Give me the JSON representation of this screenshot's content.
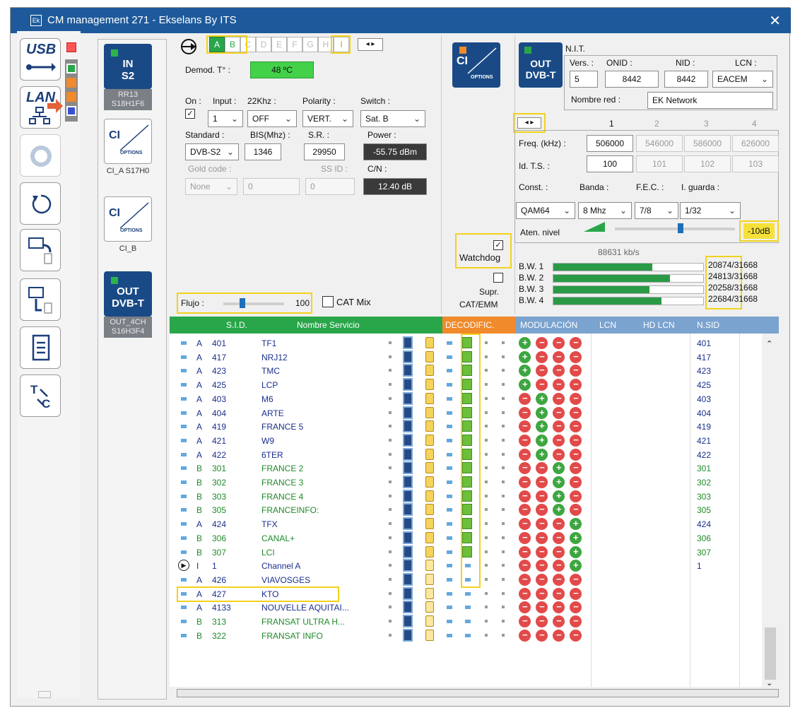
{
  "window": {
    "title": "CM management 271 - Ekselans By ITS",
    "icon": "Ek",
    "close": "✕"
  },
  "left_toolbar": {
    "usb": "USB",
    "lan": "LAN"
  },
  "device_panel": {
    "in_module": {
      "line1": "IN",
      "line2": "S2",
      "caption": "RR13 S18H1F6"
    },
    "ci_a": {
      "label": "CI",
      "sub": "OPTIONS",
      "caption": "CI_A S17H0"
    },
    "ci_b": {
      "label": "CI",
      "sub": "OPTIONS",
      "caption": "CI_B"
    },
    "out_module": {
      "line1": "OUT",
      "line2": "DVB-T",
      "caption": "OUT_4CH S16H3F4"
    }
  },
  "input_panel": {
    "tabs": [
      "A",
      "B",
      "C",
      "D",
      "E",
      "F",
      "G",
      "H",
      "I"
    ],
    "demod_label": "Demod. T° :",
    "demod_value": "48 ºC",
    "on_label": "On :",
    "input_label": "Input :",
    "khz_label": "22Khz :",
    "polarity_label": "Polarity :",
    "switch_label": "Switch :",
    "input_value": "1",
    "khz_value": "OFF",
    "polarity_value": "VERT.",
    "switch_value": "Sat. B",
    "standard_label": "Standard :",
    "bis_label": "BIS(Mhz) :",
    "sr_label": "S.R. :",
    "power_label": "Power :",
    "standard_value": "DVB-S2",
    "bis_value": "1346",
    "sr_value": "29950",
    "power_value": "-55.75 dBm",
    "gold_label": "Gold code :",
    "ssid_label": "SS ID :",
    "cn_label": "C/N :",
    "gold_value": "None",
    "gold_num": "0",
    "ssid_value": "0",
    "cn_value": "12.40 dB",
    "flujo_label": "Flujo :",
    "flujo_value": "100",
    "flujo_level": 0.3,
    "catmix_label": "CAT Mix"
  },
  "ci_panel": {
    "label": "CI",
    "sub": "OPTIONS",
    "watchdog": "Watchdog",
    "supr": "Supr.",
    "catemm": "CAT/EMM"
  },
  "out_panel": {
    "line1": "OUT",
    "line2": "DVB-T",
    "nit": "N.I.T.",
    "vers_label": "Vers. :",
    "onid_label": "ONID :",
    "nid_label": "NID :",
    "lcn_label": "LCN :",
    "vers_value": "5",
    "onid_value": "8442",
    "nid_value": "8442",
    "lcn_value": "EACEM",
    "red_label": "Nombre red :",
    "red_value": "EK Network",
    "channels": [
      "1",
      "2",
      "3",
      "4"
    ],
    "freq_label": "Freq. (kHz) :",
    "freqs": [
      "506000",
      "546000",
      "586000",
      "626000"
    ],
    "ts_label": "Id. T.S. :",
    "ts": [
      "100",
      "101",
      "102",
      "103"
    ],
    "const_label": "Const. :",
    "banda_label": "Banda :",
    "fec_label": "F.E.C. :",
    "guard_label": "I. guarda :",
    "const_value": "QAM64",
    "banda_value": "8 Mhz",
    "fec_value": "7/8",
    "guard_value": "1/32",
    "aten_label": "Aten. nivel",
    "aten_value": "-10dB",
    "aten_level": 0.55,
    "rate": "88631 kb/s",
    "bw": [
      {
        "label": "B.W. 1",
        "value": "20874/31668",
        "fill": 0.66
      },
      {
        "label": "B.W. 2",
        "value": "24813/31668",
        "fill": 0.78
      },
      {
        "label": "B.W. 3",
        "value": "20258/31668",
        "fill": 0.64
      },
      {
        "label": "B.W. 4",
        "value": "22684/31668",
        "fill": 0.72
      }
    ]
  },
  "table": {
    "headers": {
      "sid": "S.I.D.",
      "name": "Nombre Servicio",
      "decod": "DECODIFIC.",
      "mod": "MODULACIÓN",
      "lcn": "LCN",
      "hdlcn": "HD LCN",
      "nsid": "N.SID"
    },
    "rows": [
      {
        "tab": "A",
        "sid": "401",
        "name": "TF1",
        "mod": [
          1,
          0,
          0,
          0
        ],
        "nsid": "401",
        "green": false,
        "dec": true
      },
      {
        "tab": "A",
        "sid": "417",
        "name": "NRJ12",
        "mod": [
          1,
          0,
          0,
          0
        ],
        "nsid": "417",
        "green": false,
        "dec": true
      },
      {
        "tab": "A",
        "sid": "423",
        "name": "TMC",
        "mod": [
          1,
          0,
          0,
          0
        ],
        "nsid": "423",
        "green": false,
        "dec": true
      },
      {
        "tab": "A",
        "sid": "425",
        "name": "LCP",
        "mod": [
          1,
          0,
          0,
          0
        ],
        "nsid": "425",
        "green": false,
        "dec": true
      },
      {
        "tab": "A",
        "sid": "403",
        "name": "M6",
        "mod": [
          0,
          1,
          0,
          0
        ],
        "nsid": "403",
        "green": false,
        "dec": true
      },
      {
        "tab": "A",
        "sid": "404",
        "name": "ARTE",
        "mod": [
          0,
          1,
          0,
          0
        ],
        "nsid": "404",
        "green": false,
        "dec": true
      },
      {
        "tab": "A",
        "sid": "419",
        "name": "FRANCE 5",
        "mod": [
          0,
          1,
          0,
          0
        ],
        "nsid": "419",
        "green": false,
        "dec": true
      },
      {
        "tab": "A",
        "sid": "421",
        "name": "W9",
        "mod": [
          0,
          1,
          0,
          0
        ],
        "nsid": "421",
        "green": false,
        "dec": true
      },
      {
        "tab": "A",
        "sid": "422",
        "name": "6TER",
        "mod": [
          0,
          1,
          0,
          0
        ],
        "nsid": "422",
        "green": false,
        "dec": true
      },
      {
        "tab": "B",
        "sid": "301",
        "name": "FRANCE 2",
        "mod": [
          0,
          0,
          1,
          0
        ],
        "nsid": "301",
        "green": true,
        "dec": true
      },
      {
        "tab": "B",
        "sid": "302",
        "name": "FRANCE 3",
        "mod": [
          0,
          0,
          1,
          0
        ],
        "nsid": "302",
        "green": true,
        "dec": true
      },
      {
        "tab": "B",
        "sid": "303",
        "name": "FRANCE 4",
        "mod": [
          0,
          0,
          1,
          0
        ],
        "nsid": "303",
        "green": true,
        "dec": true
      },
      {
        "tab": "B",
        "sid": "305",
        "name": "FRANCEINFO:",
        "mod": [
          0,
          0,
          1,
          0
        ],
        "nsid": "305",
        "green": true,
        "dec": true
      },
      {
        "tab": "A",
        "sid": "424",
        "name": "TFX",
        "mod": [
          0,
          0,
          0,
          1
        ],
        "nsid": "424",
        "green": false,
        "dec": true
      },
      {
        "tab": "B",
        "sid": "306",
        "name": "CANAL+",
        "mod": [
          0,
          0,
          0,
          1
        ],
        "nsid": "306",
        "green": true,
        "dec": true
      },
      {
        "tab": "B",
        "sid": "307",
        "name": "LCI",
        "mod": [
          0,
          0,
          0,
          1
        ],
        "nsid": "307",
        "green": true,
        "dec": true
      },
      {
        "tab": "I",
        "sid": "1",
        "name": "Channel A",
        "mod": [
          0,
          0,
          0,
          1
        ],
        "nsid": "1",
        "green": false,
        "dec": false
      },
      {
        "tab": "A",
        "sid": "426",
        "name": "VIAVOSGES",
        "mod": [
          0,
          0,
          0,
          0
        ],
        "nsid": "",
        "green": false,
        "dec": false
      },
      {
        "tab": "A",
        "sid": "427",
        "name": "KTO",
        "mod": [
          0,
          0,
          0,
          0
        ],
        "nsid": "",
        "green": false,
        "dec": false
      },
      {
        "tab": "A",
        "sid": "4133",
        "name": "NOUVELLE AQUITAI...",
        "mod": [
          0,
          0,
          0,
          0
        ],
        "nsid": "",
        "green": false,
        "dec": false
      },
      {
        "tab": "B",
        "sid": "313",
        "name": "FRANSAT ULTRA H...",
        "mod": [
          0,
          0,
          0,
          0
        ],
        "nsid": "",
        "green": true,
        "dec": false
      },
      {
        "tab": "B",
        "sid": "322",
        "name": "FRANSAT INFO",
        "mod": [
          0,
          0,
          0,
          0
        ],
        "nsid": "",
        "green": true,
        "dec": false
      }
    ]
  },
  "colors": {
    "title": "#1e5a9b",
    "header_green": "#2aa64a",
    "header_orange": "#f08a2a",
    "header_blue": "#7aa3cf",
    "highlight": "#f3d21b",
    "service_blue": "#1a2f8c",
    "service_green": "#1f8a2a"
  }
}
